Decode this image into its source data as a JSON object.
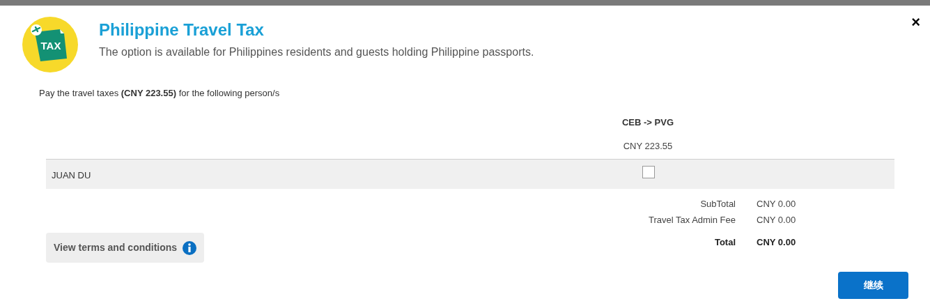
{
  "dialog": {
    "title": "Philippine Travel Tax",
    "subtitle": "The option is available for Philippines residents and guests holding Philippine passports.",
    "icon_label": "TAX",
    "close": "×"
  },
  "intro": "Pay the travel taxes **(CNY 223.55)** for the following person/s",
  "table": {
    "segment": "CEB -> PVG",
    "segment_price": "CNY 223.55",
    "rows": [
      {
        "name": "JUAN DU",
        "checked": false
      }
    ]
  },
  "totals": [
    {
      "label": "SubTotal",
      "value": "CNY 0.00",
      "bold": false
    },
    {
      "label": "Travel Tax Admin Fee",
      "value": "CNY 0.00",
      "bold": false
    },
    {
      "label": "Total",
      "value": "CNY 0.00",
      "bold": true
    }
  ],
  "terms_button": "View terms and conditions",
  "continue_button": "继续"
}
